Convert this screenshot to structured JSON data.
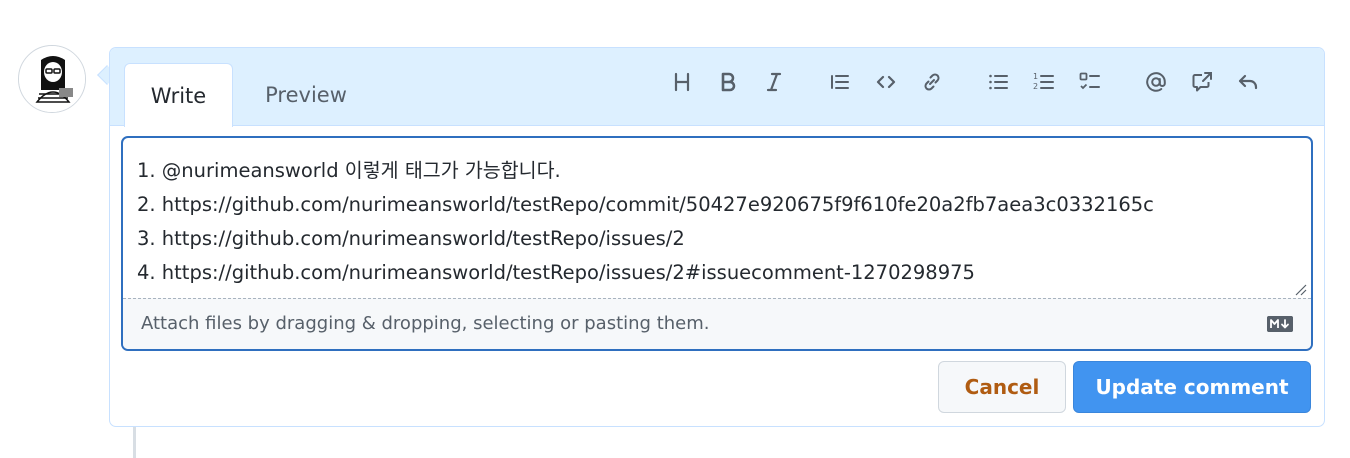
{
  "tabs": {
    "write": "Write",
    "preview": "Preview"
  },
  "toolbar": {
    "heading": "H",
    "icons": [
      "heading-icon",
      "bold-icon",
      "italic-icon",
      "quote-icon",
      "code-icon",
      "link-icon",
      "unordered-list-icon",
      "ordered-list-icon",
      "task-list-icon",
      "mention-icon",
      "cross-reference-icon",
      "reply-icon"
    ]
  },
  "editor": {
    "lines": [
      "1. @nurimeansworld 이렇게 태그가 가능합니다.",
      "2. https://github.com/nurimeansworld/testRepo/commit/50427e920675f9f610fe20a2fb7aea3c0332165c",
      "3. https://github.com/nurimeansworld/testRepo/issues/2",
      "4. https://github.com/nurimeansworld/testRepo/issues/2#issuecomment-1270298975"
    ],
    "attach_hint": "Attach files by dragging & dropping, selecting or pasting them.",
    "markdown_icon": "markdown-icon"
  },
  "actions": {
    "cancel": "Cancel",
    "update": "Update comment"
  },
  "colors": {
    "accent": "#4194f0",
    "focus_border": "#2f6fbf",
    "header_bg": "#ddf0ff",
    "cancel_text": "#b05c12"
  }
}
